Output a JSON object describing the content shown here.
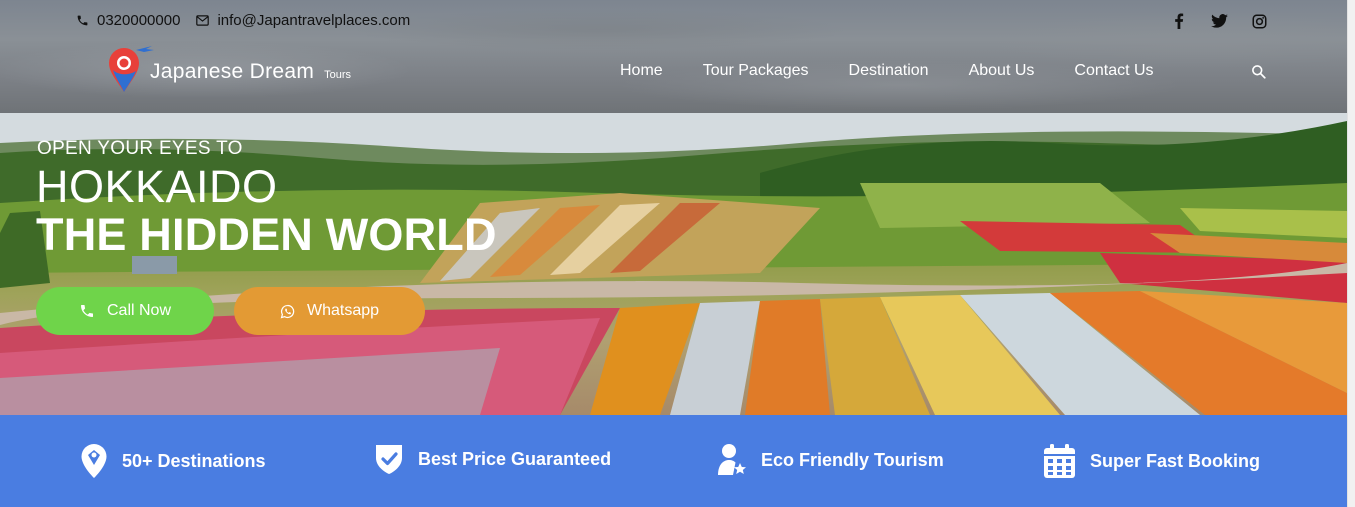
{
  "topbar": {
    "phone": "0320000000",
    "email": "info@Japantravelplaces.com"
  },
  "socials": [
    "facebook-icon",
    "twitter-icon",
    "instagram-icon"
  ],
  "logo": {
    "name": "Japanese Dream",
    "sub": "Tours"
  },
  "nav": {
    "items": [
      "Home",
      "Tour Packages",
      "Destination",
      "About Us",
      "Contact Us"
    ]
  },
  "hero": {
    "kicker": "OPEN YOUR EYES TO",
    "title_line1": "HOKKAIDO",
    "title_line2": "THE HIDDEN WORLD",
    "call_label": "Call Now",
    "whatsapp_label": "Whatsapp"
  },
  "features": [
    {
      "icon": "map-pin-icon",
      "label": "50+ Destinations"
    },
    {
      "icon": "shield-check-icon",
      "label": "Best Price Guaranteed"
    },
    {
      "icon": "user-star-icon",
      "label": "Eco Friendly Tourism"
    },
    {
      "icon": "calendar-icon",
      "label": "Super Fast Booking"
    }
  ],
  "colors": {
    "call_button": "#6fd44a",
    "whatsapp_button": "#e39a34",
    "feature_strip": "#4a7de1"
  }
}
